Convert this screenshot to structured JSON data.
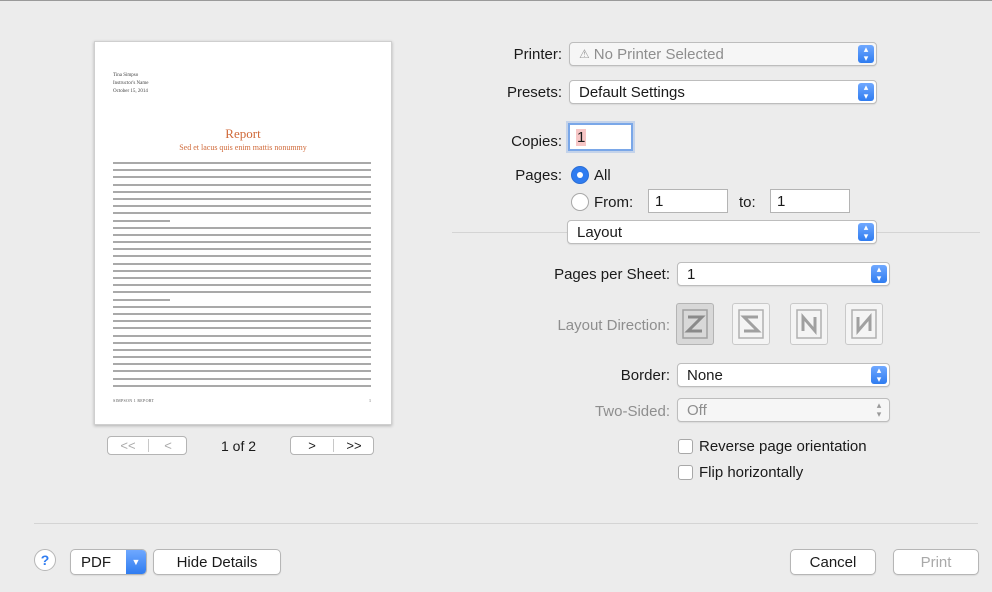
{
  "preview": {
    "meta_lines": [
      "Tina Simpso",
      "Instructor's Name",
      "October 15, 2014"
    ],
    "title": "Report",
    "subtitle": "Sed et lacus quis enim mattis nonummy",
    "footer_left": "SIMPSON 1 REPORT",
    "footer_right": "1",
    "page_indicator": "1 of 2",
    "first_label": "<<",
    "prev_label": "<",
    "next_label": ">",
    "last_label": ">>"
  },
  "printer": {
    "label": "Printer:",
    "value": "No Printer Selected"
  },
  "presets": {
    "label": "Presets:",
    "value": "Default Settings"
  },
  "copies": {
    "label": "Copies:",
    "value": "1"
  },
  "pages": {
    "label": "Pages:",
    "all_label": "All",
    "from_label": "From:",
    "from_value": "1",
    "to_label": "to:",
    "to_value": "1",
    "selected": "All"
  },
  "section": {
    "value": "Layout"
  },
  "layout": {
    "pages_per_sheet_label": "Pages per Sheet:",
    "pages_per_sheet_value": "1",
    "direction_label": "Layout Direction:",
    "direction_icons": [
      "z-direction-icon",
      "reverse-z-direction-icon",
      "n-direction-icon",
      "reverse-n-direction-icon"
    ],
    "border_label": "Border:",
    "border_value": "None",
    "two_sided_label": "Two-Sided:",
    "two_sided_value": "Off",
    "reverse_label": "Reverse page orientation",
    "reverse_checked": false,
    "flip_label": "Flip horizontally",
    "flip_checked": false
  },
  "footer": {
    "help_label": "?",
    "pdf_label": "PDF",
    "hide_details_label": "Hide Details",
    "cancel_label": "Cancel",
    "print_label": "Print"
  },
  "colors": {
    "accent": "#2f7cf0",
    "title_orange": "#d06a3a"
  }
}
